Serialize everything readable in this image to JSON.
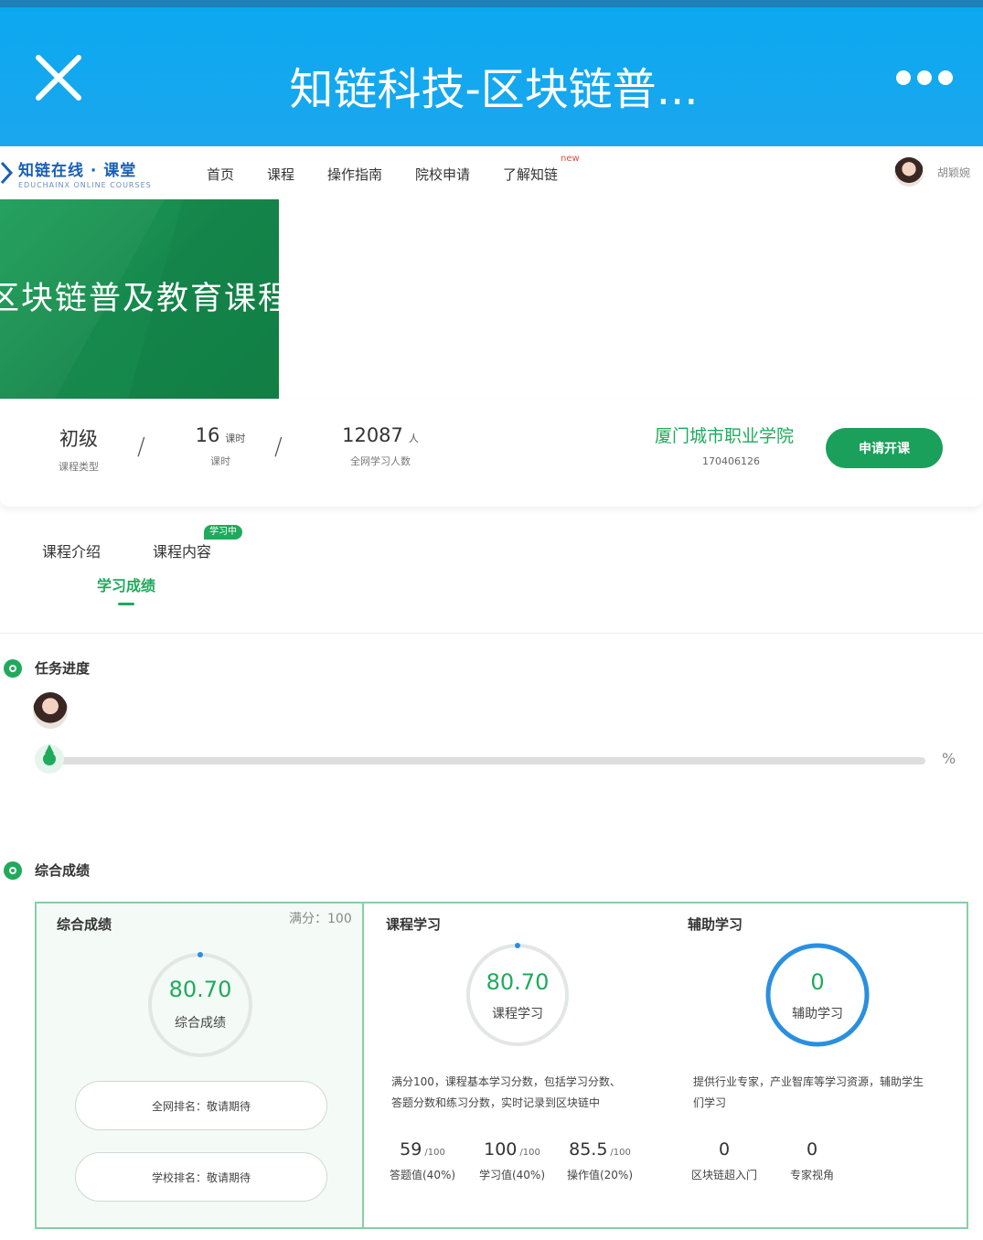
{
  "window": {
    "title": "知链科技-区块链普...",
    "close_icon": "close-icon",
    "more_icon": "more-dots-icon"
  },
  "nav": {
    "logo_main": "知链在线 · 课堂",
    "logo_sub": "EDUCHAINX ONLINE COURSES",
    "items": [
      "首页",
      "课程",
      "操作指南",
      "院校申请",
      "了解知链"
    ],
    "new_badge": "new",
    "user_name": "胡颖婉"
  },
  "banner": {
    "title": "区块链普及教育课程",
    "color": "#1e9e58"
  },
  "course_info": {
    "level": "初级",
    "level_label": "课程类型",
    "hours": "16",
    "hours_unit": "课时",
    "hours_label": "课时",
    "learners": "12087",
    "learners_unit": "人",
    "learners_label": "全网学习人数",
    "school_name": "厦门城市职业学院",
    "school_code": "170406126",
    "apply_label": "申请开课"
  },
  "tabs": {
    "intro": "课程介绍",
    "content": "课程内容",
    "content_badge": "学习中",
    "score": "学习成绩",
    "active": "score"
  },
  "task_progress": {
    "title": "任务进度",
    "percent_label": "%",
    "percent_value": 0
  },
  "overall": {
    "title": "综合成绩",
    "panel_title": "综合成绩",
    "full_score": "满分：100",
    "score": "80.70",
    "score_label": "综合成绩",
    "rank_network": "全网排名：敬请期待",
    "rank_school": "学校排名：敬请期待"
  },
  "course_study": {
    "title": "课程学习",
    "score": "80.70",
    "score_label": "课程学习",
    "desc_line1": "满分100，课程基本学习分数，包括学习分数、",
    "desc_line2": "答题分数和练习分数，实时记录到区块链中",
    "items": [
      {
        "value": "59",
        "max": "/100",
        "label": "答题值(40%)"
      },
      {
        "value": "100",
        "max": "/100",
        "label": "学习值(40%)"
      },
      {
        "value": "85.5",
        "max": "/100",
        "label": "操作值(20%)"
      }
    ]
  },
  "assist_study": {
    "title": "辅助学习",
    "score": "0",
    "score_label": "辅助学习",
    "desc_line1": "提供行业专家，产业智库等学习资源，辅助学生",
    "desc_line2": "们学习",
    "items": [
      {
        "value": "0",
        "label": "区块链超入门"
      },
      {
        "value": "0",
        "label": "专家视角"
      }
    ]
  },
  "colors": {
    "accent_green": "#1faa5c",
    "header_blue": "#0aa8f0",
    "ring_blue": "#2a8fe0"
  }
}
